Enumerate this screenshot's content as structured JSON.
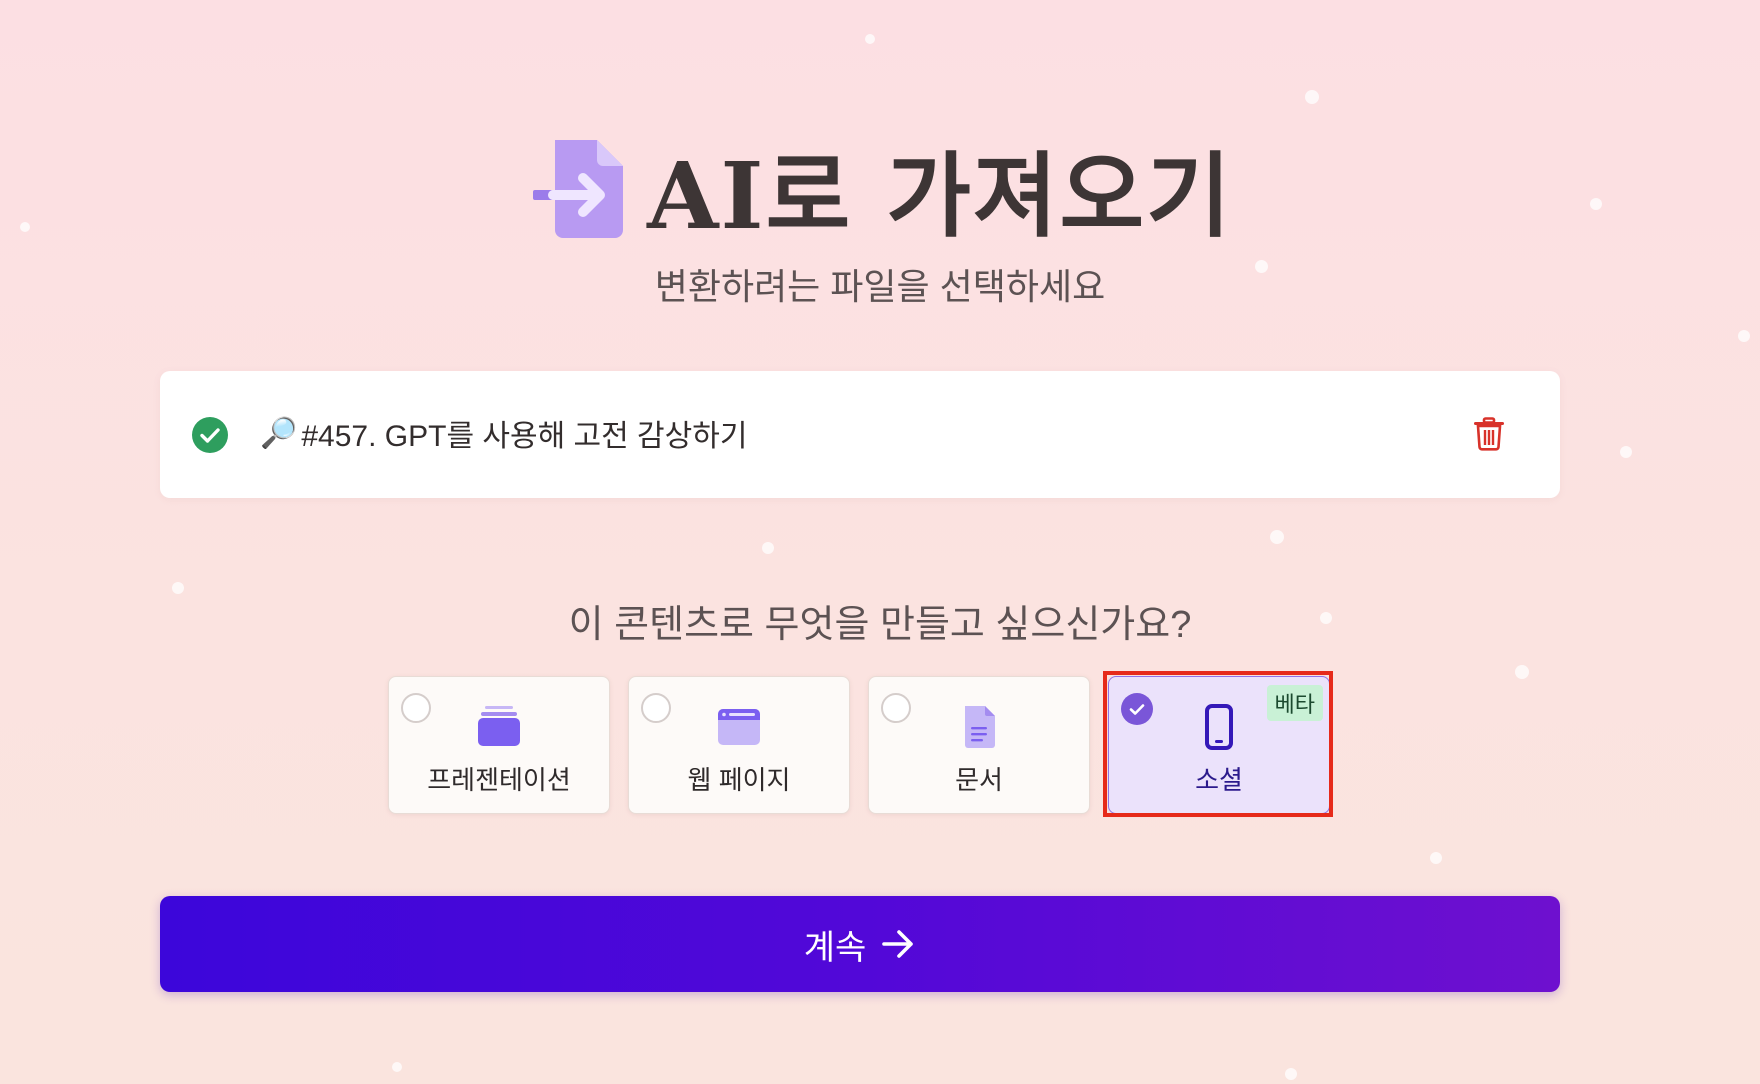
{
  "header": {
    "title": "AI로 가져오기",
    "subtitle": "변환하려는 파일을 선택하세요",
    "icon": "file-import-icon"
  },
  "file": {
    "emoji": "🔎",
    "title": "#457. GPT를 사용해 고전 감상하기",
    "status_icon": "check-circle-icon",
    "delete_icon": "trash-icon"
  },
  "question": "이 콘텐츠로 무엇을 만들고 싶으신가요?",
  "options": [
    {
      "label": "프레젠테이션",
      "icon": "presentation-icon",
      "selected": false
    },
    {
      "label": "웹 페이지",
      "icon": "webpage-icon",
      "selected": false
    },
    {
      "label": "문서",
      "icon": "document-icon",
      "selected": false
    },
    {
      "label": "소셜",
      "icon": "mobile-icon",
      "selected": true,
      "badge": "베타"
    }
  ],
  "continue_button": {
    "label": "계속",
    "icon": "arrow-right-icon"
  },
  "colors": {
    "accent": "#5a0bd6",
    "success": "#2e9e5e",
    "danger": "#d8322a",
    "icon_purple": "#8a6cf0"
  }
}
